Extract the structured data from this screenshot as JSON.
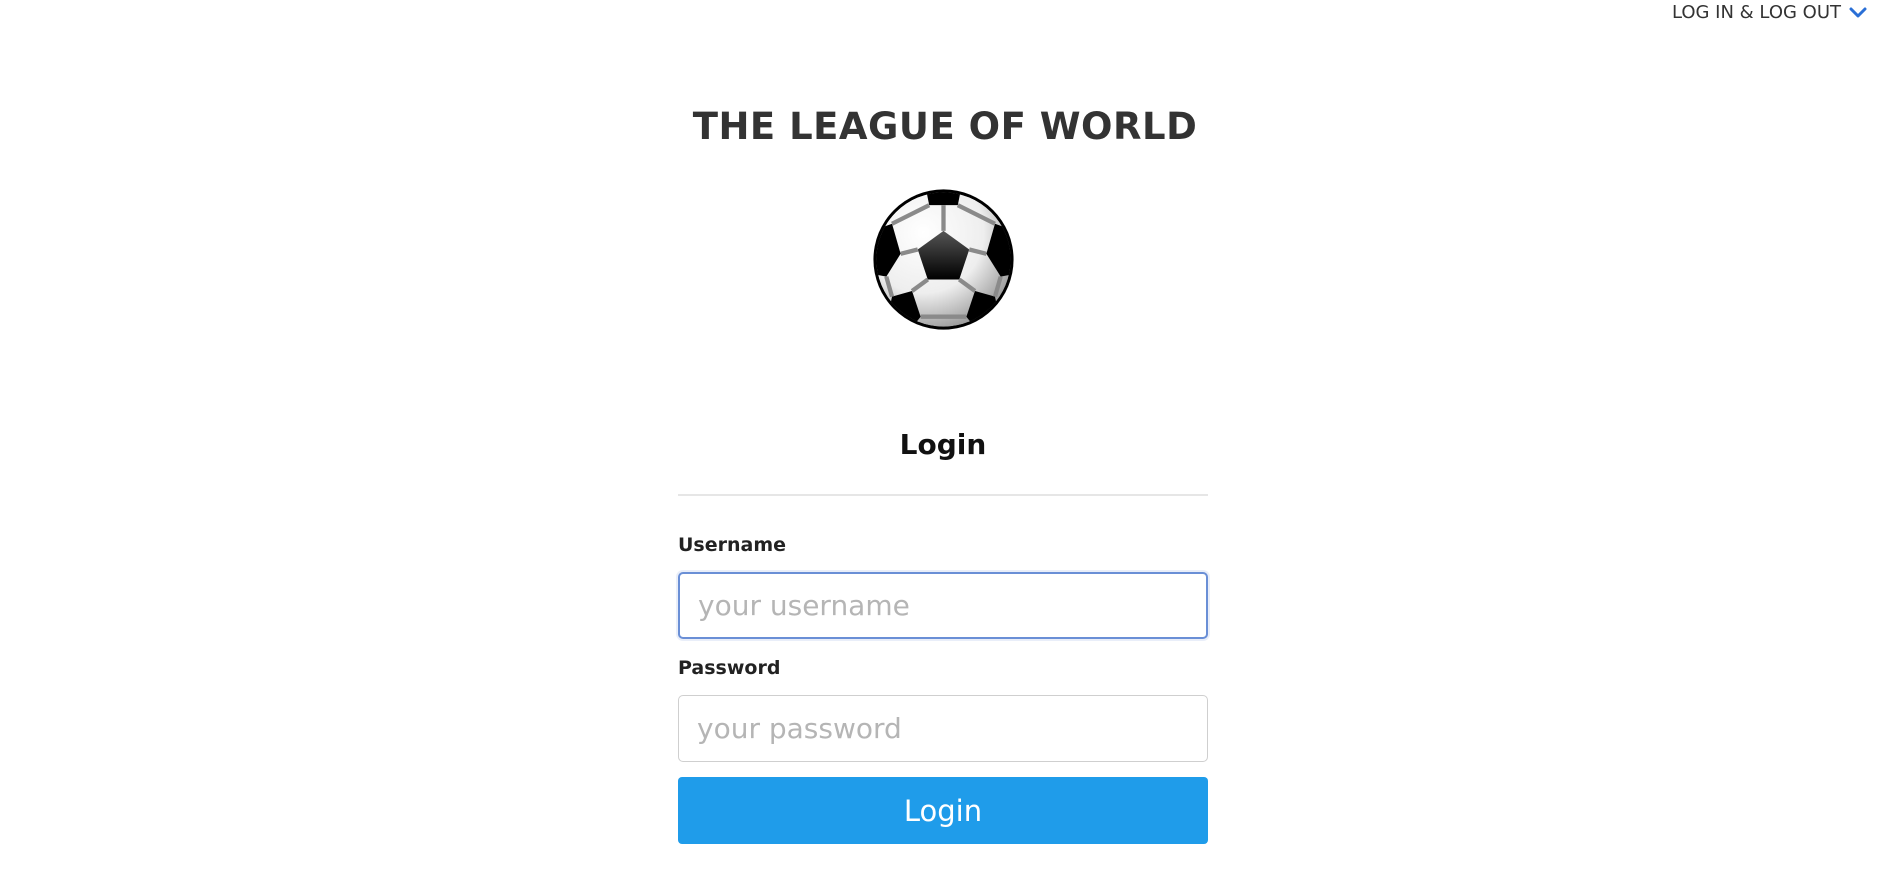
{
  "header": {
    "menu_label": "LOG IN & LOG OUT",
    "menu_icon": "chevron-down-icon",
    "accent_color": "#2a6fd6"
  },
  "site": {
    "title": "THE LEAGUE OF WORLD",
    "logo_icon": "soccer-ball-icon"
  },
  "login": {
    "title": "Login",
    "username_label": "Username",
    "username_placeholder": "your username",
    "username_value": "",
    "password_label": "Password",
    "password_placeholder": "your password",
    "password_value": "",
    "submit_label": "Login",
    "button_color": "#1f9cea"
  }
}
